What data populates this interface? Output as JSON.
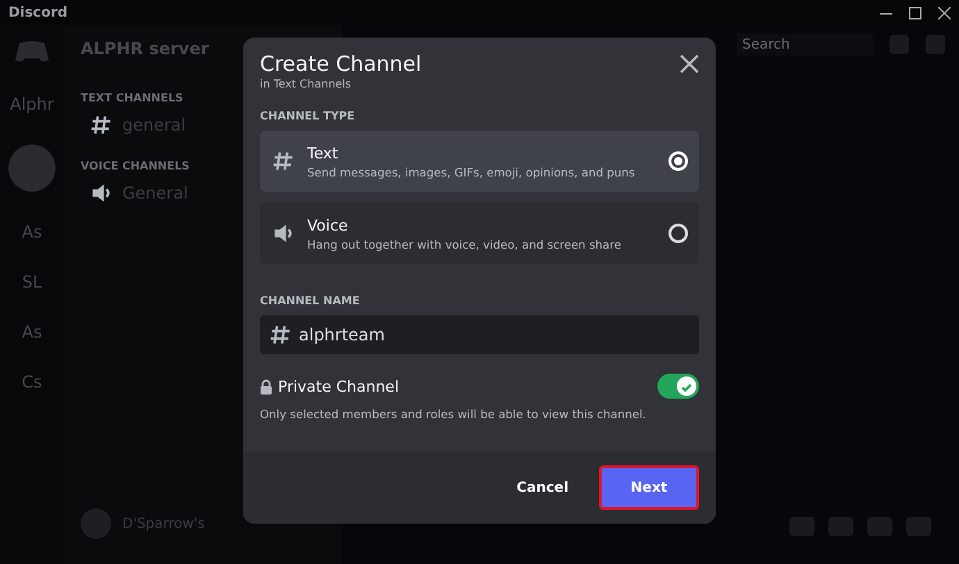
{
  "window": {
    "title": "Discord"
  },
  "servers": [
    {
      "label": "Alphr",
      "kind": "text"
    },
    {
      "kind": "avatar"
    },
    {
      "label": "As",
      "kind": "text"
    },
    {
      "label": "SL",
      "kind": "text"
    },
    {
      "label": "As",
      "kind": "text"
    },
    {
      "label": "Cs",
      "kind": "text"
    }
  ],
  "sidebar": {
    "server_name": "ALPHR server",
    "categories": [
      {
        "label": "TEXT CHANNELS",
        "channels": [
          {
            "name": "general",
            "kind": "text"
          }
        ]
      },
      {
        "label": "VOICE CHANNELS",
        "channels": [
          {
            "name": "General",
            "kind": "voice"
          }
        ]
      }
    ],
    "user": {
      "name": "D'Sparrow's"
    }
  },
  "search": {
    "placeholder": "Search"
  },
  "dialog": {
    "title": "Create Channel",
    "subtitle": "in Text Channels",
    "type_heading": "CHANNEL TYPE",
    "types": [
      {
        "kind": "text",
        "label": "Text",
        "description": "Send messages, images, GIFs, emoji, opinions, and puns",
        "selected": true
      },
      {
        "kind": "voice",
        "label": "Voice",
        "description": "Hang out together with voice, video, and screen share",
        "selected": false
      }
    ],
    "name_heading": "CHANNEL NAME",
    "name_value": "alphrteam",
    "private": {
      "label": "Private Channel",
      "on": true,
      "description": "Only selected members and roles will be able to view this channel."
    },
    "buttons": {
      "cancel": "Cancel",
      "next": "Next"
    }
  }
}
